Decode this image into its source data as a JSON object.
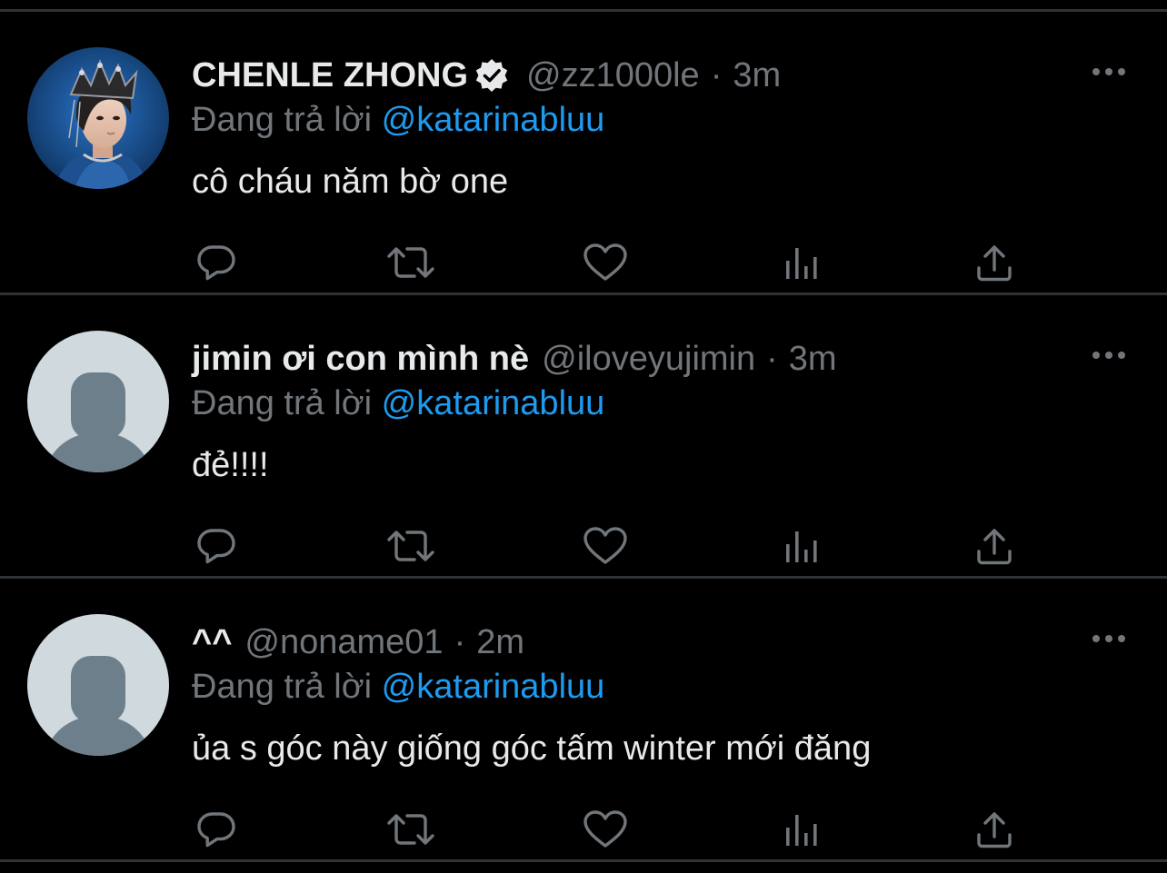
{
  "colors": {
    "background": "#000000",
    "divider": "#2f3336",
    "primary_text": "#e7e9ea",
    "secondary_text": "#71767b",
    "link": "#1d9bf0",
    "icon": "#71767b"
  },
  "icons": {
    "reply": "speech-bubble-icon",
    "retweet": "retweet-icon",
    "like": "heart-icon",
    "views": "bar-chart-icon",
    "share": "share-upload-icon",
    "more": "more-dots-icon",
    "verified": "verified-badge-icon"
  },
  "tweets": [
    {
      "display_name": "CHENLE ZHONG",
      "verified": true,
      "handle": "@zz1000le",
      "separator": "·",
      "time": "3m",
      "reply_prefix": "Đang trả lời",
      "reply_to": "@katarinabluu",
      "text": "cô cháu năm bờ one",
      "avatar": "photo"
    },
    {
      "display_name": "jimin ơi con mình nè",
      "verified": false,
      "handle": "@iloveyujimin",
      "separator": "·",
      "time": "3m",
      "reply_prefix": "Đang trả lời",
      "reply_to": "@katarinabluu",
      "text": "đẻ!!!!",
      "avatar": "default"
    },
    {
      "display_name": "^^",
      "verified": false,
      "handle": "@noname01",
      "separator": "·",
      "time": "2m",
      "reply_prefix": "Đang trả lời",
      "reply_to": "@katarinabluu",
      "text": "ủa s góc này giống góc tấm winter mới đăng",
      "avatar": "default"
    }
  ]
}
